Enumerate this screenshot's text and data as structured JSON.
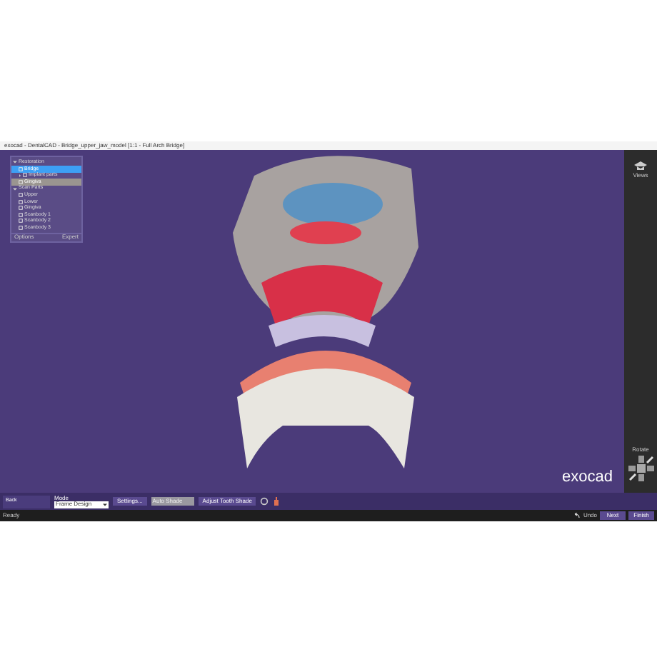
{
  "window": {
    "title": "exocad - DentalCAD - Bridge_upper_jaw_model [1:1 - Full Arch Bridge]"
  },
  "scene_panel": {
    "groups": [
      {
        "label": "Restoration",
        "expanded": true,
        "items": [
          {
            "label": "Bridge",
            "selected": true
          },
          {
            "label": "Implant parts",
            "selected": false,
            "expandable": true
          },
          {
            "label": "Gingiva",
            "selected": false,
            "highlighted": true
          }
        ]
      },
      {
        "label": "Scan Parts",
        "expanded": true,
        "items": [
          {
            "label": "Upper",
            "selected": false
          },
          {
            "label": "Lower",
            "selected": false
          },
          {
            "label": "Gingiva",
            "selected": false
          },
          {
            "label": "Scanbody 1",
            "selected": false
          },
          {
            "label": "Scanbody 2",
            "selected": false
          },
          {
            "label": "Scanbody 3",
            "selected": false
          }
        ]
      }
    ],
    "footer_left": "Options",
    "footer_right": "Expert"
  },
  "right_toolbar": {
    "top_label": "Views",
    "bottom_label": "Rotate"
  },
  "logo": "exocad",
  "bottom_bar": {
    "mode_button": "Back",
    "group_label": "Mode",
    "dropdown_value": "Frame Design",
    "settings_button": "Settings...",
    "disabled_field": "Auto Shade",
    "shade_button": "Adjust Tooth Shade",
    "undo_label": "Undo",
    "next_button": "Next",
    "finish_button": "Finish"
  },
  "status": "Ready"
}
